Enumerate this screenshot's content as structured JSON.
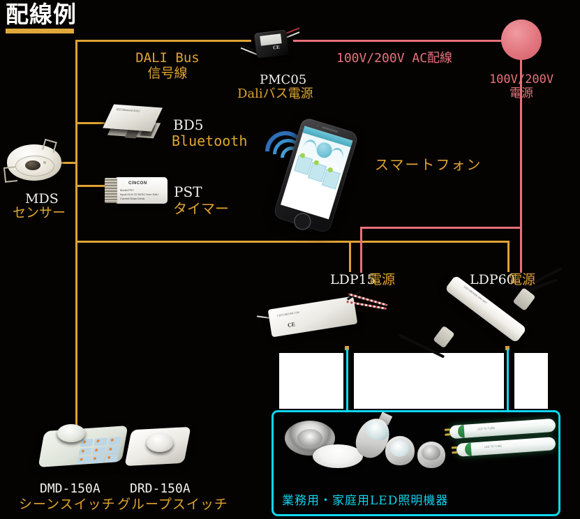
{
  "page": {
    "title": "配線例",
    "background_color": "#050302",
    "accent_gold": "#dfa233",
    "accent_red": "#e8707a",
    "accent_cyan": "#10d6f0"
  },
  "labels": {
    "dali_bus_line1": "DALI Bus",
    "dali_bus_line2": "信号線",
    "ac_wiring": "100V/200V AC配線",
    "power_source_line1": "100V/200V",
    "power_source_line2": "電源",
    "pmc05_name": "PMC05",
    "pmc05_desc": "Daliバス電源",
    "mds_name": "MDS",
    "mds_desc": "センサー",
    "bd5_name": "BD5",
    "bd5_desc": "Bluetooth",
    "pst_name": "PST",
    "pst_desc": "タイマー",
    "smartphone": "スマートフォン",
    "ldp15_name": "LDP15",
    "ldp15_desc": "電源",
    "ldp60_name": "LDP60",
    "ldp60_desc": "電源",
    "dmd_name": "DMD-150A",
    "dmd_desc": "シーンスイッチ",
    "drd_name": "DRD-150A",
    "drd_desc": "グループスイッチ",
    "led_panel_caption": "業務用・家庭用LED照明機器"
  },
  "device_text": {
    "pst_brand": "CINCON",
    "pst_spec_line1": "Model:PST",
    "pst_spec_line2": "Input:13.5~22.5VDC from DALI",
    "pst_spec_line3": "Current Draw:10mA",
    "pmc05_ce": "CE",
    "ldp15_ce": "CE",
    "ldp15_spec": "LED DRIVER  15W",
    "ldp60_spec": "LED DRIVER  60W  IP67",
    "bd5_spec": "BD5 Bluetooth DALI",
    "tube_text": "LED T8 TUBE"
  },
  "icons": {
    "wifi": "wifi-icon",
    "power_node": "power-source-node",
    "sensor": "motion-sensor-icon"
  }
}
